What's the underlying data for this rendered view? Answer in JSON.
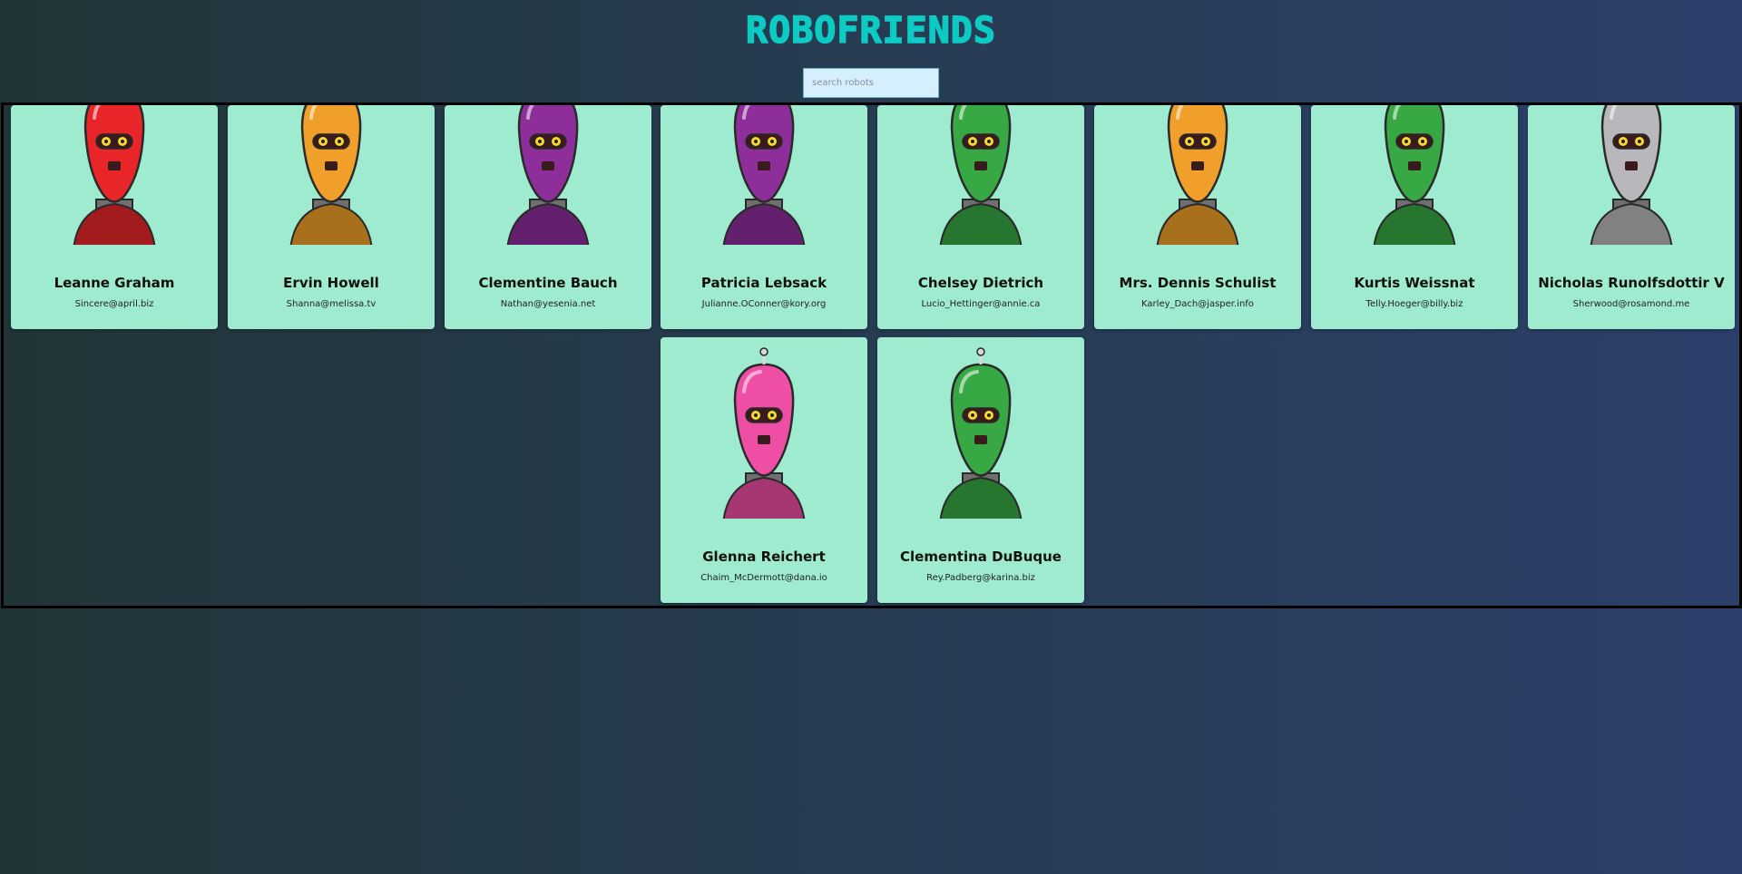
{
  "header": {
    "title": "ROBOFRIENDS"
  },
  "search": {
    "placeholder": "search robots",
    "value": ""
  },
  "robots": [
    {
      "name": "Leanne Graham",
      "email": "Sincere@april.biz",
      "color": "#e8262a"
    },
    {
      "name": "Ervin Howell",
      "email": "Shanna@melissa.tv",
      "color": "#f0a02a"
    },
    {
      "name": "Clementine Bauch",
      "email": "Nathan@yesenia.net",
      "color": "#8e2e9a"
    },
    {
      "name": "Patricia Lebsack",
      "email": "Julianne.OConner@kory.org",
      "color": "#8e2e9a"
    },
    {
      "name": "Chelsey Dietrich",
      "email": "Lucio_Hettinger@annie.ca",
      "color": "#38a845"
    },
    {
      "name": "Mrs. Dennis Schulist",
      "email": "Karley_Dach@jasper.info",
      "color": "#f0a02a"
    },
    {
      "name": "Kurtis Weissnat",
      "email": "Telly.Hoeger@billy.biz",
      "color": "#38a845"
    },
    {
      "name": "Nicholas Runolfsdottir V",
      "email": "Sherwood@rosamond.me",
      "color": "#b8b8bc"
    },
    {
      "name": "Glenna Reichert",
      "email": "Chaim_McDermott@dana.io",
      "color": "#ee4fa4"
    },
    {
      "name": "Clementina DuBuque",
      "email": "Rey.Padberg@karina.biz",
      "color": "#38a845"
    }
  ]
}
